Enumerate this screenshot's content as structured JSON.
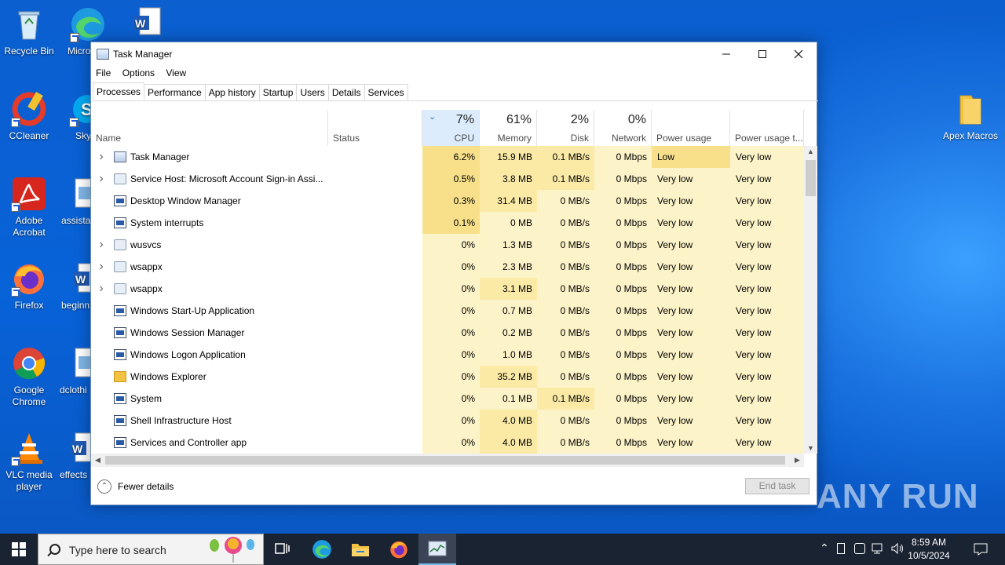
{
  "desktop": {
    "icons": [
      {
        "label": "Recycle Bin"
      },
      {
        "label": "Micro Edg"
      },
      {
        "label": ""
      },
      {
        "label": "CCleaner"
      },
      {
        "label": "Sky"
      },
      {
        "label": "Adobe Acrobat"
      },
      {
        "label": "assista"
      },
      {
        "label": "Firefox"
      },
      {
        "label": "beginn"
      },
      {
        "label": "Google Chrome"
      },
      {
        "label": "dclothi"
      },
      {
        "label": "VLC media player"
      },
      {
        "label": "effects"
      },
      {
        "label": "Apex Macros"
      }
    ]
  },
  "window": {
    "title": "Task Manager",
    "menu": [
      "File",
      "Options",
      "View"
    ],
    "tabs": [
      "Processes",
      "Performance",
      "App history",
      "Startup",
      "Users",
      "Details",
      "Services"
    ],
    "active_tab": "Processes",
    "columns": {
      "name": "Name",
      "status": "Status",
      "cpu_pct": "7%",
      "cpu": "CPU",
      "mem_pct": "61%",
      "mem": "Memory",
      "disk_pct": "2%",
      "disk": "Disk",
      "net_pct": "0%",
      "net": "Network",
      "power": "Power usage",
      "power_trend": "Power usage t..."
    },
    "processes": [
      {
        "name": "Task Manager",
        "expand": true,
        "icon": "task-manager-icon",
        "cpu": "6.2%",
        "mem": "15.9 MB",
        "disk": "0.1 MB/s",
        "net": "0 Mbps",
        "power": "Low",
        "power_trend": "Very low"
      },
      {
        "name": "Service Host: Microsoft Account Sign-in Assi...",
        "expand": true,
        "icon": "service-gear-icon",
        "cpu": "0.5%",
        "mem": "3.8 MB",
        "disk": "0.1 MB/s",
        "net": "0 Mbps",
        "power": "Very low",
        "power_trend": "Very low"
      },
      {
        "name": "Desktop Window Manager",
        "expand": false,
        "icon": "app-window-icon",
        "cpu": "0.3%",
        "mem": "31.4 MB",
        "disk": "0 MB/s",
        "net": "0 Mbps",
        "power": "Very low",
        "power_trend": "Very low"
      },
      {
        "name": "System interrupts",
        "expand": false,
        "icon": "app-window-icon",
        "cpu": "0.1%",
        "mem": "0 MB",
        "disk": "0 MB/s",
        "net": "0 Mbps",
        "power": "Very low",
        "power_trend": "Very low"
      },
      {
        "name": "wusvcs",
        "expand": true,
        "icon": "service-gear-icon",
        "cpu": "0%",
        "mem": "1.3 MB",
        "disk": "0 MB/s",
        "net": "0 Mbps",
        "power": "Very low",
        "power_trend": "Very low"
      },
      {
        "name": "wsappx",
        "expand": true,
        "icon": "service-gear-icon",
        "cpu": "0%",
        "mem": "2.3 MB",
        "disk": "0 MB/s",
        "net": "0 Mbps",
        "power": "Very low",
        "power_trend": "Very low"
      },
      {
        "name": "wsappx",
        "expand": true,
        "icon": "service-gear-icon",
        "cpu": "0%",
        "mem": "3.1 MB",
        "disk": "0 MB/s",
        "net": "0 Mbps",
        "power": "Very low",
        "power_trend": "Very low"
      },
      {
        "name": "Windows Start-Up Application",
        "expand": false,
        "icon": "app-window-icon",
        "cpu": "0%",
        "mem": "0.7 MB",
        "disk": "0 MB/s",
        "net": "0 Mbps",
        "power": "Very low",
        "power_trend": "Very low"
      },
      {
        "name": "Windows Session Manager",
        "expand": false,
        "icon": "app-window-icon",
        "cpu": "0%",
        "mem": "0.2 MB",
        "disk": "0 MB/s",
        "net": "0 Mbps",
        "power": "Very low",
        "power_trend": "Very low"
      },
      {
        "name": "Windows Logon Application",
        "expand": false,
        "icon": "app-window-icon",
        "cpu": "0%",
        "mem": "1.0 MB",
        "disk": "0 MB/s",
        "net": "0 Mbps",
        "power": "Very low",
        "power_trend": "Very low"
      },
      {
        "name": "Windows Explorer",
        "expand": false,
        "icon": "folder-icon",
        "cpu": "0%",
        "mem": "35.2 MB",
        "disk": "0 MB/s",
        "net": "0 Mbps",
        "power": "Very low",
        "power_trend": "Very low"
      },
      {
        "name": "System",
        "expand": false,
        "icon": "app-window-icon",
        "cpu": "0%",
        "mem": "0.1 MB",
        "disk": "0.1 MB/s",
        "net": "0 Mbps",
        "power": "Very low",
        "power_trend": "Very low"
      },
      {
        "name": "Shell Infrastructure Host",
        "expand": false,
        "icon": "app-window-icon",
        "cpu": "0%",
        "mem": "4.0 MB",
        "disk": "0 MB/s",
        "net": "0 Mbps",
        "power": "Very low",
        "power_trend": "Very low"
      },
      {
        "name": "Services and Controller app",
        "expand": false,
        "icon": "app-window-icon",
        "cpu": "0%",
        "mem": "4.0 MB",
        "disk": "0 MB/s",
        "net": "0 Mbps",
        "power": "Very low",
        "power_trend": "Very low"
      }
    ],
    "footer": {
      "fewer_details": "Fewer details",
      "end_task": "End task"
    }
  },
  "taskbar": {
    "search_placeholder": "Type here to search",
    "time": "8:59 AM",
    "date": "10/5/2024"
  },
  "watermark": "ANY RUN",
  "colors": {
    "heat_dark": "#f8e08b",
    "heat_mid": "#faeaa6",
    "heat_light": "#fdf3c8",
    "sorted_header": "#dcecfc",
    "accent": "#0078d7"
  }
}
